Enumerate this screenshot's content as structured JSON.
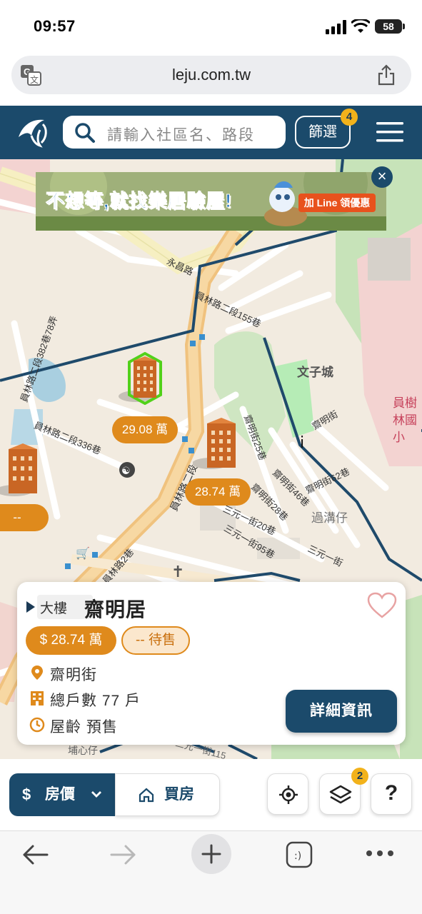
{
  "status_bar": {
    "time": "09:57",
    "battery": "58"
  },
  "browser": {
    "url": "leju.com.tw"
  },
  "header": {
    "search_placeholder": "請輸入社區名、路段",
    "filter_label": "篩選",
    "filter_badge": "4"
  },
  "banner": {
    "headline": "不想等,就找樂居驗屋!",
    "cta": "加 Line 領優惠",
    "close_label": "×"
  },
  "map": {
    "road_labels": [
      "永昌路",
      "員林路二段155巷",
      "員林路二段382巷78弄",
      "員林路二段336巷",
      "員林路二段",
      "齋明街25巷",
      "齋明街46巷",
      "齋明街28巷",
      "齋明街62巷",
      "齋明街",
      "三元一街20巷",
      "三元一街95巷",
      "三元一街",
      "員林路2巷",
      "埔心仔",
      "三元一街115"
    ],
    "place_labels": [
      "文子城",
      "過溝仔",
      "員樹林國小"
    ],
    "price_markers": [
      "29.08 萬",
      "28.74 萬",
      "--"
    ]
  },
  "card": {
    "type": "大樓",
    "name": "齋明居",
    "price": "$ 28.74 萬",
    "sale_status": "-- 待售",
    "street": "齋明街",
    "households": "總戶數 77 戶",
    "age": "屋齡 預售",
    "detail_button": "詳細資訊"
  },
  "bottom_bar": {
    "tab_price": "房價",
    "tab_buy": "買房",
    "layers_badge": "2",
    "help_label": "?"
  },
  "colors": {
    "brand_navy": "#1b4a6b",
    "accent_orange": "#df8a1c",
    "badge_yellow": "#f2b21b"
  }
}
